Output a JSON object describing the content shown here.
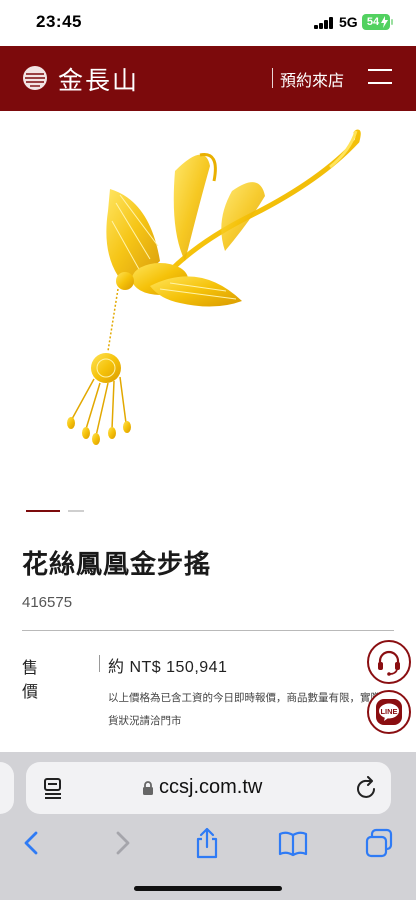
{
  "status_bar": {
    "time": "23:45",
    "network": "5G",
    "battery": "54"
  },
  "header": {
    "logo_text": "金長山",
    "reserve_label": "預約來店",
    "brand_color": "#7c0a0c"
  },
  "product": {
    "title": "花絲鳳凰金步搖",
    "code": "416575",
    "price_label": "售價",
    "price_value": "約 NT$ 150,941",
    "price_note_line1": "以上價格為已含工資的今日即時報價，商品數量有限，實際現",
    "price_note_line2": "貨狀況請洽門市",
    "image_icon": "gold-phoenix-hairpin-image"
  },
  "carousel": {
    "slide_count": 2,
    "active_index": 0
  },
  "floating_buttons": {
    "support_icon": "headset-icon",
    "line_label": "LINE"
  },
  "browser": {
    "url": "ccsj.com.tw",
    "toolbar_icons": [
      "back-icon",
      "forward-icon",
      "share-icon",
      "bookmarks-icon",
      "tabs-icon"
    ],
    "accent": "#2f7bf5"
  }
}
